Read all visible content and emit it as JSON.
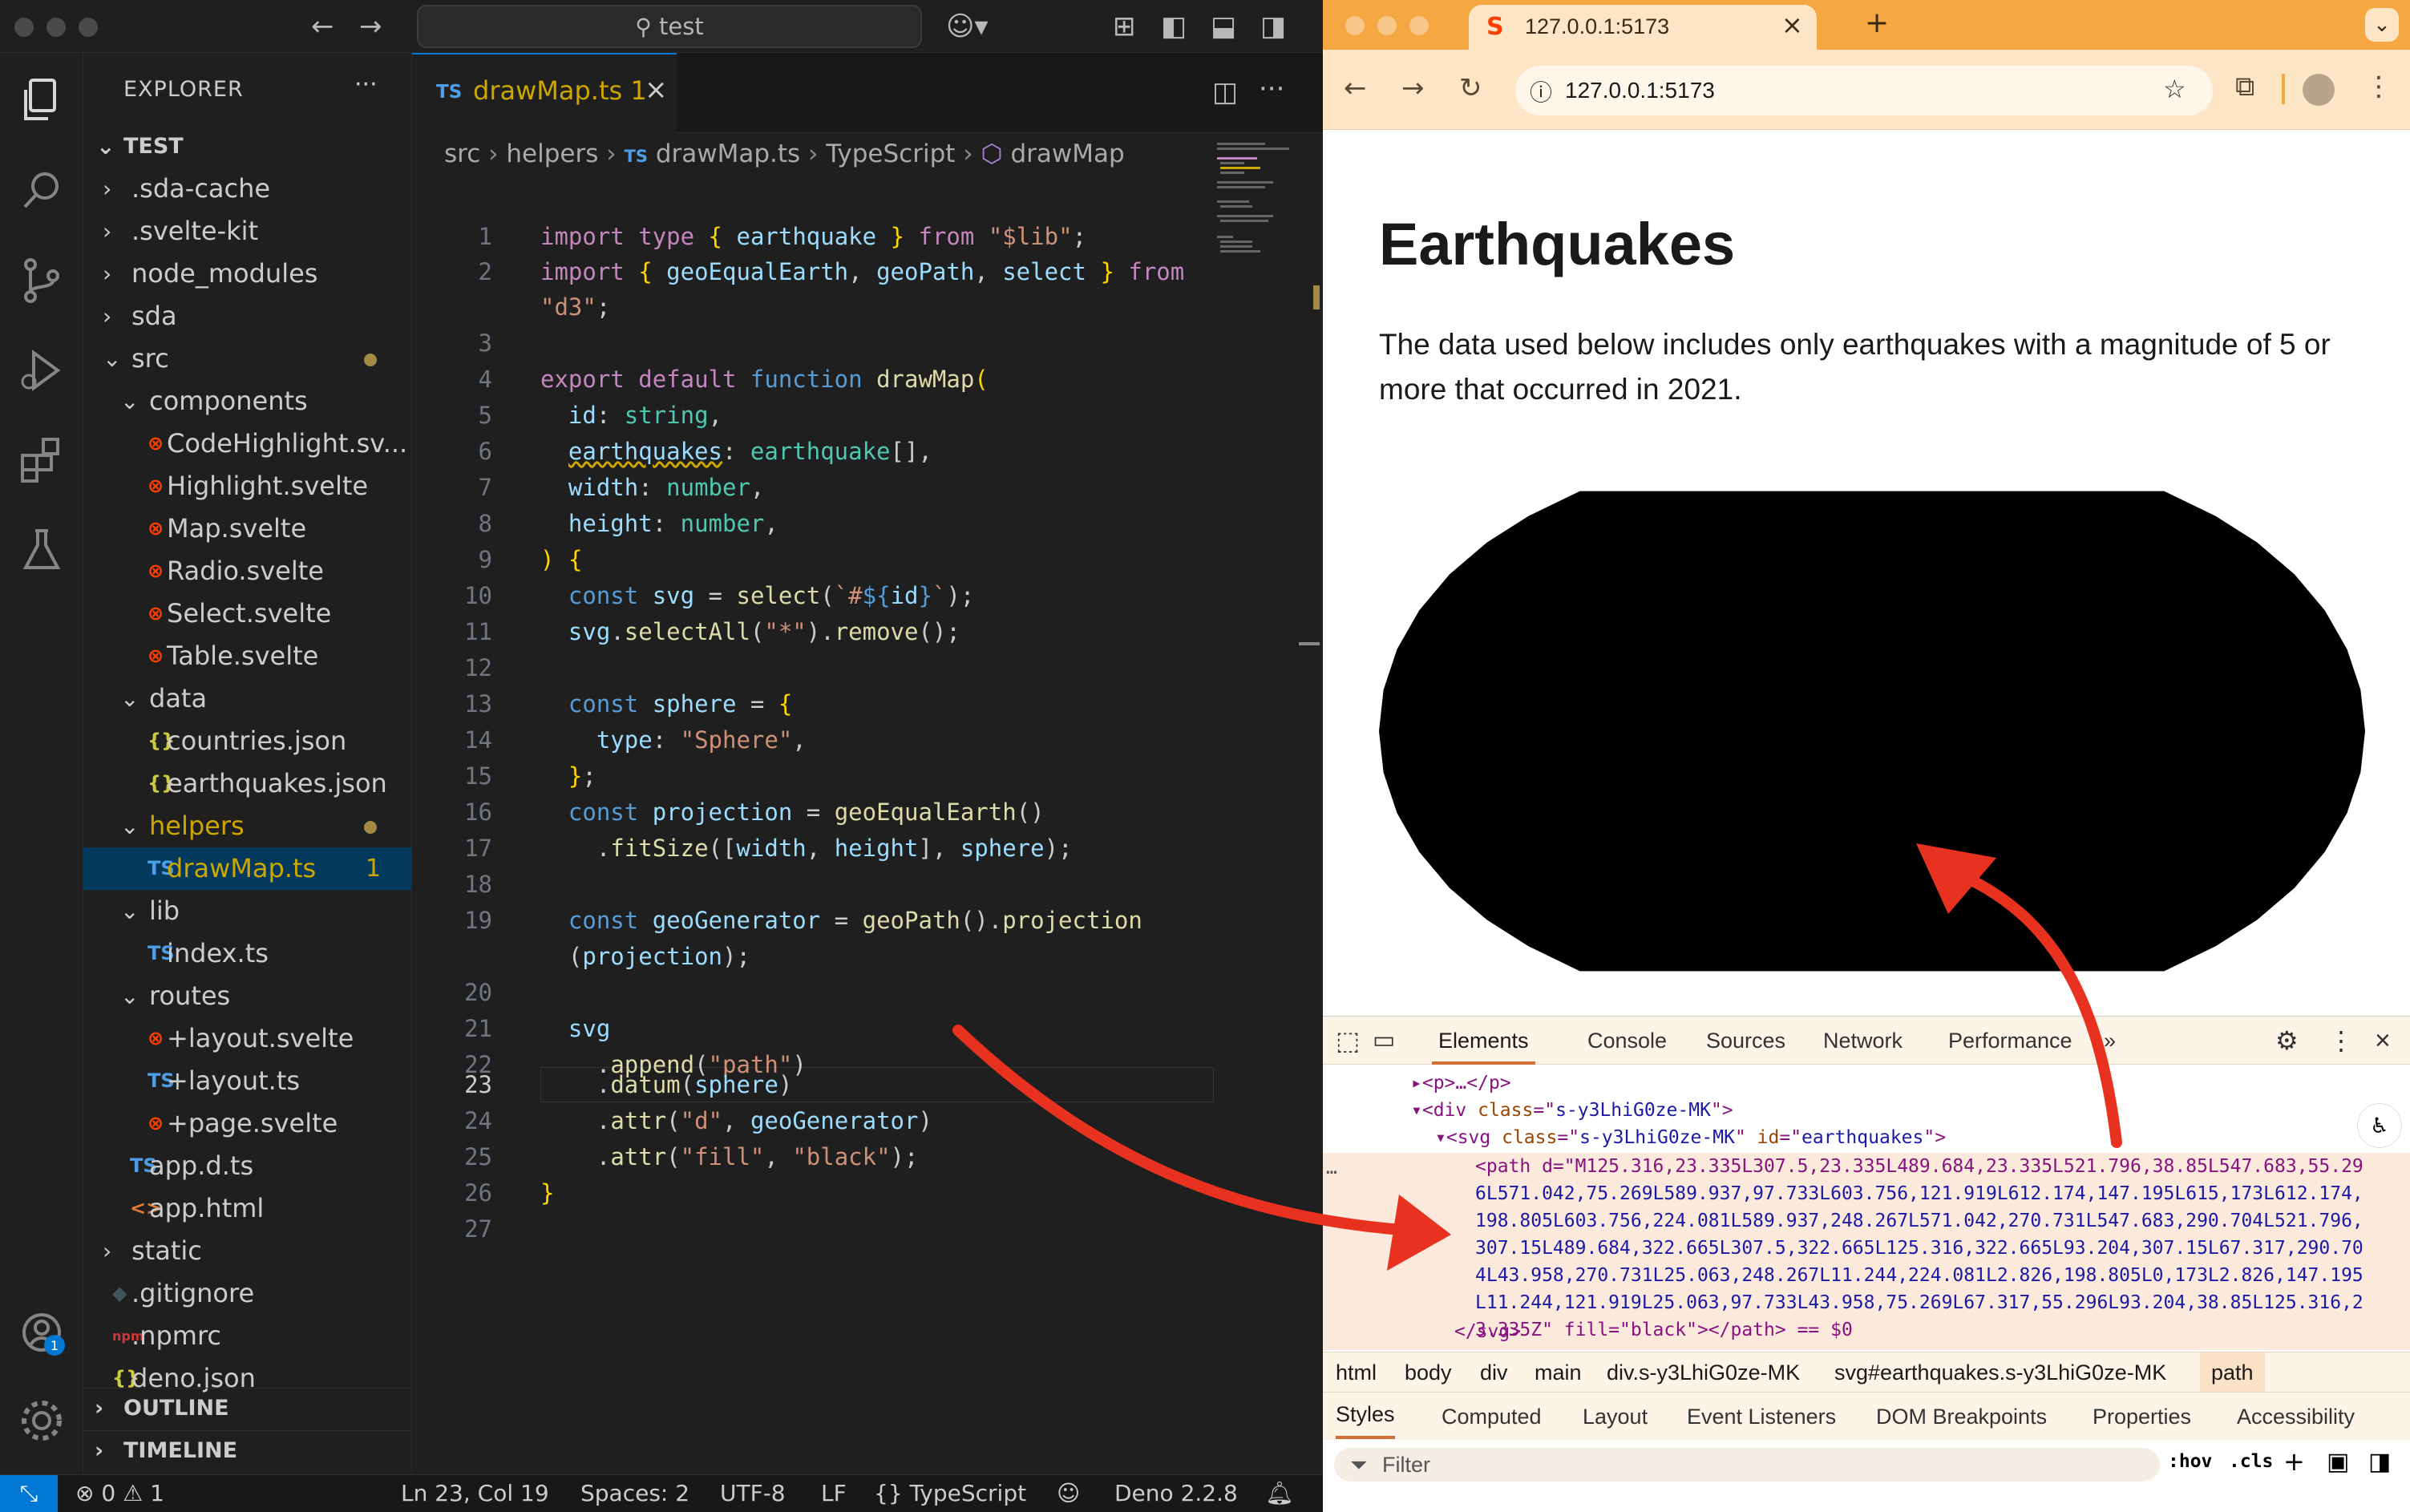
{
  "vscode": {
    "command_center": "test",
    "explorer_title": "EXPLORER",
    "explorer_more": "···",
    "root_folder": "TEST",
    "tree": [
      {
        "label": ".sda-cache",
        "indent": 0,
        "type": "folder-collapsed"
      },
      {
        "label": ".svelte-kit",
        "indent": 0,
        "type": "folder-collapsed"
      },
      {
        "label": "node_modules",
        "indent": 0,
        "type": "folder-collapsed"
      },
      {
        "label": "sda",
        "indent": 0,
        "type": "folder-collapsed"
      },
      {
        "label": "src",
        "indent": 0,
        "type": "folder-open",
        "modified": true
      },
      {
        "label": "components",
        "indent": 1,
        "type": "folder-open"
      },
      {
        "label": "CodeHighlight.sv...",
        "indent": 2,
        "type": "svelte"
      },
      {
        "label": "Highlight.svelte",
        "indent": 2,
        "type": "svelte"
      },
      {
        "label": "Map.svelte",
        "indent": 2,
        "type": "svelte"
      },
      {
        "label": "Radio.svelte",
        "indent": 2,
        "type": "svelte"
      },
      {
        "label": "Select.svelte",
        "indent": 2,
        "type": "svelte"
      },
      {
        "label": "Table.svelte",
        "indent": 2,
        "type": "svelte"
      },
      {
        "label": "data",
        "indent": 1,
        "type": "folder-open"
      },
      {
        "label": "countries.json",
        "indent": 2,
        "type": "json"
      },
      {
        "label": "earthquakes.json",
        "indent": 2,
        "type": "json"
      },
      {
        "label": "helpers",
        "indent": 1,
        "type": "folder-open",
        "modified": true,
        "warn": true
      },
      {
        "label": "drawMap.ts",
        "indent": 2,
        "type": "ts",
        "selected": true,
        "warn": true,
        "badge": "1"
      },
      {
        "label": "lib",
        "indent": 1,
        "type": "folder-open"
      },
      {
        "label": "index.ts",
        "indent": 2,
        "type": "ts"
      },
      {
        "label": "routes",
        "indent": 1,
        "type": "folder-open"
      },
      {
        "label": "+layout.svelte",
        "indent": 2,
        "type": "svelte"
      },
      {
        "label": "+layout.ts",
        "indent": 2,
        "type": "ts"
      },
      {
        "label": "+page.svelte",
        "indent": 2,
        "type": "svelte"
      },
      {
        "label": "app.d.ts",
        "indent": 1,
        "type": "ts"
      },
      {
        "label": "app.html",
        "indent": 1,
        "type": "html"
      },
      {
        "label": "static",
        "indent": 0,
        "type": "folder-collapsed"
      },
      {
        "label": ".gitignore",
        "indent": 0,
        "type": "git"
      },
      {
        "label": ".npmrc",
        "indent": 0,
        "type": "npm"
      },
      {
        "label": "deno.json",
        "indent": 0,
        "type": "json"
      }
    ],
    "outline_label": "OUTLINE",
    "timeline_label": "TIMELINE",
    "tab": {
      "lang": "TS",
      "name": "drawMap.ts 1",
      "close": "×"
    },
    "breadcrumb": [
      "src",
      "helpers",
      "drawMap.ts",
      "TypeScript",
      "drawMap"
    ],
    "status": {
      "problems": "0",
      "warnings": "1",
      "position": "Ln 23, Col 19",
      "spaces": "Spaces: 2",
      "encoding": "UTF-8",
      "eol": "LF",
      "language": "TypeScript",
      "runtime": "Deno 2.2.8"
    },
    "accounts_badge": "1"
  },
  "browser": {
    "tab_title": "127.0.0.1:5173",
    "url": "127.0.0.1:5173",
    "page_title": "Earthquakes",
    "page_text": "The data used below includes only earthquakes with a magnitude of 5 or more that occurred in 2021.",
    "devtools_tabs": [
      "Elements",
      "Console",
      "Sources",
      "Network",
      "Performance"
    ],
    "dom": {
      "p_line": "<p>…</p>",
      "div_line_class": "s-y3LhiG0ze-MK",
      "svg_class": "s-y3LhiG0ze-MK",
      "svg_id": "earthquakes",
      "path_lines": [
        "<path d=\"M125.316,23.335L307.5,23.335L489.684,23.335L521.796,38.85L547.683,55.29",
        "6L571.042,75.269L589.937,97.733L603.756,121.919L612.174,147.195L615,173L612.174,",
        "198.805L603.756,224.081L589.937,248.267L571.042,270.731L547.683,290.704L521.796,",
        "307.15L489.684,322.665L307.5,322.665L125.316,322.665L93.204,307.15L67.317,290.70",
        "4L43.958,270.731L25.063,248.267L11.244,224.081L2.826,198.805L0,173L2.826,147.195",
        "L11.244,121.919L25.063,97.733L43.958,75.269L67.317,55.296L93.204,38.85L125.316,2",
        "3.335Z\" fill=\"black\"></path> == $0"
      ],
      "svg_close": "</svg>"
    },
    "crumbs": [
      "html",
      "body",
      "div",
      "main",
      "div.s-y3LhiG0ze-MK",
      "svg#earthquakes.s-y3LhiG0ze-MK",
      "path"
    ],
    "style_tabs": [
      "Styles",
      "Computed",
      "Layout",
      "Event Listeners",
      "DOM Breakpoints",
      "Properties",
      "Accessibility"
    ],
    "filter_placeholder": "Filter",
    "filter_hov": ":hov",
    "filter_cls": ".cls"
  },
  "colors": {
    "arrow": "#e8321f",
    "chrome_frame": "#f5a742",
    "vscode_accent": "#0078d4"
  }
}
